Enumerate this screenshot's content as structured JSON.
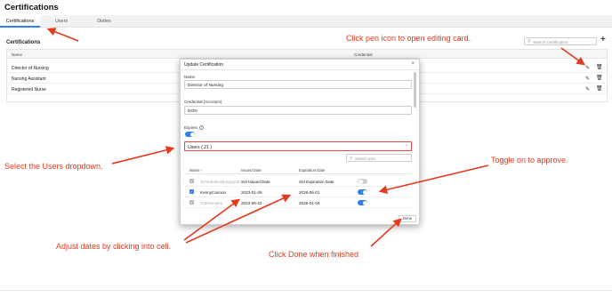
{
  "page": {
    "title": "Certifications"
  },
  "tabs": [
    {
      "label": "Certifications",
      "active": true
    },
    {
      "label": "Users",
      "active": false
    },
    {
      "label": "Duties",
      "active": false
    }
  ],
  "section": {
    "title": "Certifications",
    "search_placeholder": "Search Certification",
    "add_icon": "plus-icon"
  },
  "table": {
    "headers": {
      "name": "Name",
      "credential": "Credential"
    },
    "rows": [
      {
        "name": "Director of Nursing"
      },
      {
        "name": "Nursing Assistant"
      },
      {
        "name": "Registered Nurse"
      }
    ],
    "row_icons": [
      "pencil-icon",
      "trash-icon"
    ]
  },
  "modal": {
    "title": "Update Certification",
    "close_glyph": "×",
    "name_label": "Name",
    "name_value": "Director of Nursing",
    "credential_label": "Credential (Acronym)",
    "credential_value": "DON",
    "expires_label": "Expires",
    "expires_on": true,
    "users_dropdown": "Users ( 21 )",
    "user_search_placeholder": "Search user",
    "user_table": {
      "headers": {
        "name": "Name ↑",
        "issued": "Issued Date",
        "expiration": "Expiration Date"
      },
      "rows": [
        {
          "name": "ScheduleHelpSupport",
          "issued": "Set Issued Date",
          "expiration": "Set Expiration Date",
          "checked": true,
          "muted": true,
          "approved": false
        },
        {
          "name": "KennyCannon",
          "issued": "2023-01-26",
          "expiration": "2026-06-01",
          "checked": true,
          "muted": false,
          "approved": true
        },
        {
          "name": "CMSample2",
          "issued": "2023-05-22",
          "expiration": "2026-01-04",
          "checked": true,
          "muted": true,
          "approved": true
        }
      ]
    },
    "done_label": "Done"
  },
  "annotations": {
    "pen": "Click pen icon to open editing card.",
    "users": "Select the Users dropdown.",
    "toggle": "Toggle on to approve.",
    "dates": "Adjust dates by clicking into cell.",
    "done": "Click Done when finished"
  },
  "colors": {
    "accent": "#2f80ed",
    "annotation": "#e53a1f",
    "dropdown_border": "#e24a4a"
  }
}
